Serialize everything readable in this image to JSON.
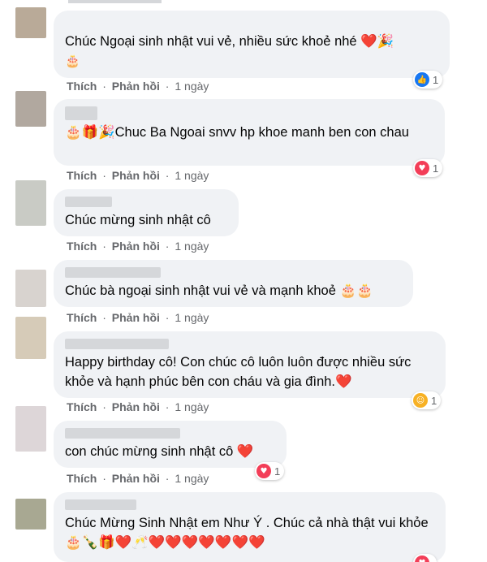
{
  "comments": [
    {
      "text": "Chúc Ngoại sinh nhật vui vẻ, nhiều sức khoẻ nhé ❤️🎉",
      "emoji_line": "🎂",
      "actions": {
        "like": "Thích",
        "reply": "Phản hồi",
        "time": "1 ngày"
      },
      "reaction": {
        "type": "like-icon",
        "count": "1"
      },
      "avatar_color": "#b9aa98"
    },
    {
      "text": "🎂🎁🎉Chuc Ba Ngoai snvv hp khoe manh ben con chau",
      "actions": {
        "like": "Thích",
        "reply": "Phản hồi",
        "time": "1 ngày"
      },
      "reaction": {
        "type": "love-icon",
        "count": "1"
      },
      "avatar_color": "#b1a89f"
    },
    {
      "text": "Chúc mừng sinh nhật cô",
      "actions": {
        "like": "Thích",
        "reply": "Phản hồi",
        "time": "1 ngày"
      },
      "avatar_color": "#c9cbc5"
    },
    {
      "text": "Chúc bà ngoại sinh nhật vui vẻ và mạnh khoẻ 🎂🎂",
      "actions": {
        "like": "Thích",
        "reply": "Phản hồi",
        "time": "1 ngày"
      },
      "avatar_color": "#d8d3cf"
    },
    {
      "text": "Happy birthday cô! Con chúc cô luôn luôn được nhiều sức khỏe và hạnh phúc bên con cháu và gia đình.❤️",
      "actions": {
        "like": "Thích",
        "reply": "Phản hồi",
        "time": "1 ngày"
      },
      "reaction": {
        "type": "care-icon",
        "count": "1"
      },
      "avatar_color": "#d6cbb8"
    },
    {
      "text": "con chúc mừng sinh nhật cô ❤️",
      "actions": {
        "like": "Thích",
        "reply": "Phản hồi",
        "time": "1 ngày"
      },
      "reaction": {
        "type": "love-icon",
        "count": "1"
      },
      "avatar_color": "#ddd6d8"
    },
    {
      "text": "Chúc Mừng Sinh Nhật em Như Ý . Chúc cả nhà thật vui khỏe 🎂🍾🎁❤️🥂❤️❤️❤️❤️❤️❤️❤️",
      "avatar_color": "#a8a892"
    }
  ],
  "colors": {
    "bubble": "#f0f2f5",
    "meta": "#65676b",
    "like": "#1877f2",
    "love": "#f33e58",
    "care": "#f7b125"
  }
}
